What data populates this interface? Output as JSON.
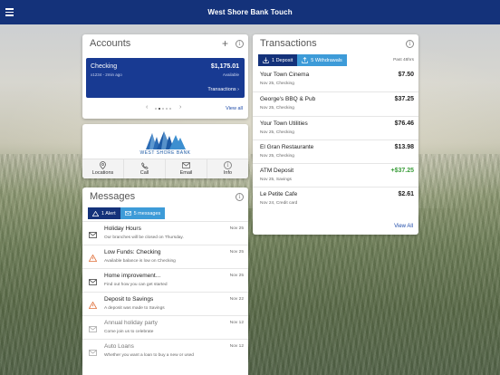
{
  "app": {
    "title": "West Shore Bank Touch"
  },
  "accounts": {
    "title": "Accounts",
    "account": {
      "name": "Checking",
      "sub": "x1234 - 2min ago",
      "balance": "$1,175.01",
      "available": "Available",
      "transactions_link": "Transactions"
    },
    "view_all": "View all"
  },
  "bank": {
    "name": "WEST SHORE BANK",
    "actions": [
      {
        "label": "Locations",
        "icon": "location-pin-icon"
      },
      {
        "label": "Call",
        "icon": "phone-icon"
      },
      {
        "label": "Email",
        "icon": "envelope-icon"
      },
      {
        "label": "Info",
        "icon": "info-icon"
      }
    ]
  },
  "messages": {
    "title": "Messages",
    "tabs": {
      "alerts": "1 Alert",
      "messages": "5 messages"
    },
    "items": [
      {
        "title": "Holiday Hours",
        "sub": "Our branches will be closed on Thursday.",
        "date": "Nov 25",
        "icon": "envelope-icon",
        "read": false
      },
      {
        "title": "Low Funds: Checking",
        "sub": "Available balance is low on Checking",
        "date": "Nov 25",
        "icon": "warning-icon",
        "read": false
      },
      {
        "title": "Home improvement...",
        "sub": "Find out how you can get started",
        "date": "Nov 25",
        "icon": "envelope-icon",
        "read": false
      },
      {
        "title": "Deposit to Savings",
        "sub": "A deposit was made to Savings",
        "date": "Nov 22",
        "icon": "warning-icon",
        "read": false
      },
      {
        "title": "Annual holiday party",
        "sub": "Come join us to celebrate",
        "date": "Nov 12",
        "icon": "envelope-icon",
        "read": true
      },
      {
        "title": "Auto Loans",
        "sub": "Whether you want a loan to buy a new or used",
        "date": "Nov 12",
        "icon": "envelope-icon",
        "read": true
      }
    ]
  },
  "transactions": {
    "title": "Transactions",
    "tabs": {
      "deposits": "1 Deposit",
      "withdrawals": "5 Withdrawals"
    },
    "past_label": "Past 48hrs",
    "items": [
      {
        "name": "Your Town Cinema",
        "sub": "Nov 25, Checking",
        "amount": "$7.50",
        "credit": false
      },
      {
        "name": "George's BBQ & Pub",
        "sub": "Nov 25, Checking",
        "amount": "$37.25",
        "credit": false
      },
      {
        "name": "Your Town Utilities",
        "sub": "Nov 25, Checking",
        "amount": "$76.46",
        "credit": false
      },
      {
        "name": "El Gran Restaurante",
        "sub": "Nov 25, Checking",
        "amount": "$13.98",
        "credit": false
      },
      {
        "name": "ATM Deposit",
        "sub": "Nov 25, Savings",
        "amount": "+$37.25",
        "credit": true
      },
      {
        "name": "Le Petite Cafe",
        "sub": "Nov 24, Credit card",
        "amount": "$2.61",
        "credit": false
      }
    ],
    "view_all": "View All"
  },
  "colors": {
    "brand_navy": "#14327a",
    "accent_blue": "#3d9bd8",
    "credit_green": "#3a9d3a",
    "warning_orange": "#e0703a"
  }
}
